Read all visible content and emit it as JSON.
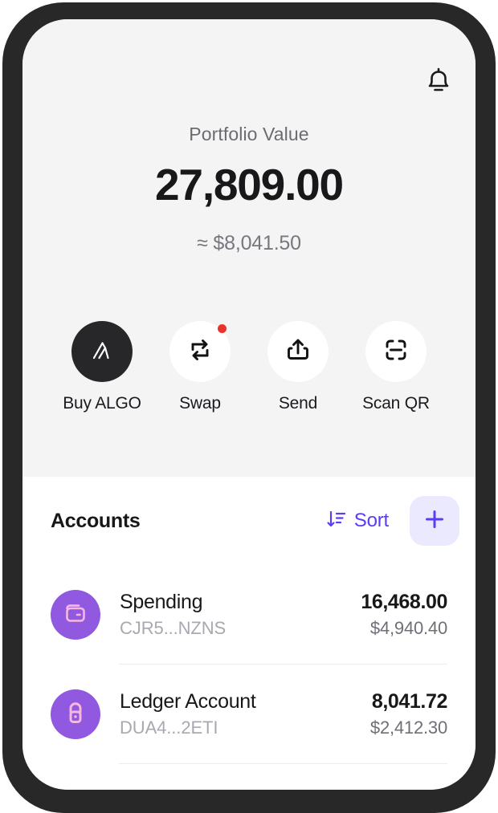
{
  "header": {
    "bell_icon": "bell-icon",
    "portfolio_label": "Portfolio Value",
    "portfolio_value": "27,809.00",
    "portfolio_fiat": "≈ $8,041.50"
  },
  "actions": [
    {
      "label": "Buy ALGO",
      "icon": "algorand-logo-icon",
      "style": "dark",
      "badge": false
    },
    {
      "label": "Swap",
      "icon": "swap-arrows-icon",
      "style": "light",
      "badge": true
    },
    {
      "label": "Send",
      "icon": "share-upload-icon",
      "style": "light",
      "badge": false
    },
    {
      "label": "Scan QR",
      "icon": "scan-qr-icon",
      "style": "light",
      "badge": false
    }
  ],
  "accounts_section": {
    "title": "Accounts",
    "sort_label": "Sort",
    "sort_icon": "sort-descending-icon",
    "add_icon": "plus-icon",
    "rows": [
      {
        "name": "Spending",
        "address": "CJR5...NZNS",
        "balance": "16,468.00",
        "fiat": "$4,940.40",
        "icon": "wallet-icon"
      },
      {
        "name": "Ledger Account",
        "address": "DUA4...2ETI",
        "balance": "8,041.72",
        "fiat": "$2,412.30",
        "icon": "ledger-lock-icon"
      }
    ]
  },
  "colors": {
    "accent_purple": "#5b3df5",
    "avatar_purple": "#9159e0",
    "avatar_icon_pink": "#f7b8e0",
    "badge_red": "#e8342a",
    "header_bg": "#f4f4f5",
    "frame": "#282828"
  }
}
